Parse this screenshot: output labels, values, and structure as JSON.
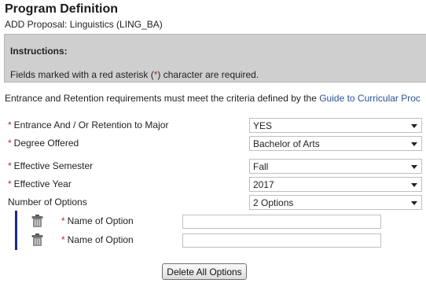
{
  "header": {
    "title": "Program Definition",
    "subtitle": "ADD Proposal: Linguistics (LING_BA)"
  },
  "instructions": {
    "heading": "Instructions:",
    "text_before": "Fields marked with a red asterisk (",
    "asterisk": "*",
    "text_after": ") character are required."
  },
  "criteria": {
    "text": "Entrance and Retention requirements must meet the criteria defined by the ",
    "link": "Guide to Curricular Proc"
  },
  "fields": {
    "entrance": {
      "required_mark": "*",
      "label": "Entrance And / Or Retention to Major",
      "value": "YES"
    },
    "degree": {
      "required_mark": "*",
      "label": "Degree Offered",
      "value": "Bachelor of Arts"
    },
    "semester": {
      "required_mark": "*",
      "label": "Effective Semester",
      "value": "Fall"
    },
    "year": {
      "required_mark": "*",
      "label": "Effective Year",
      "value": "2017"
    },
    "num_options": {
      "label": "Number of Options",
      "value": "2 Options"
    }
  },
  "options": [
    {
      "required_mark": "*",
      "label": "Name of Option",
      "value": ""
    },
    {
      "required_mark": "*",
      "label": "Name of Option",
      "value": ""
    }
  ],
  "actions": {
    "delete_all": "Delete All Options"
  },
  "colors": {
    "required": "#c0262b",
    "link": "#2a5296",
    "instructions_bg": "#cfcfcf",
    "option_bar": "#1c2a8a"
  }
}
